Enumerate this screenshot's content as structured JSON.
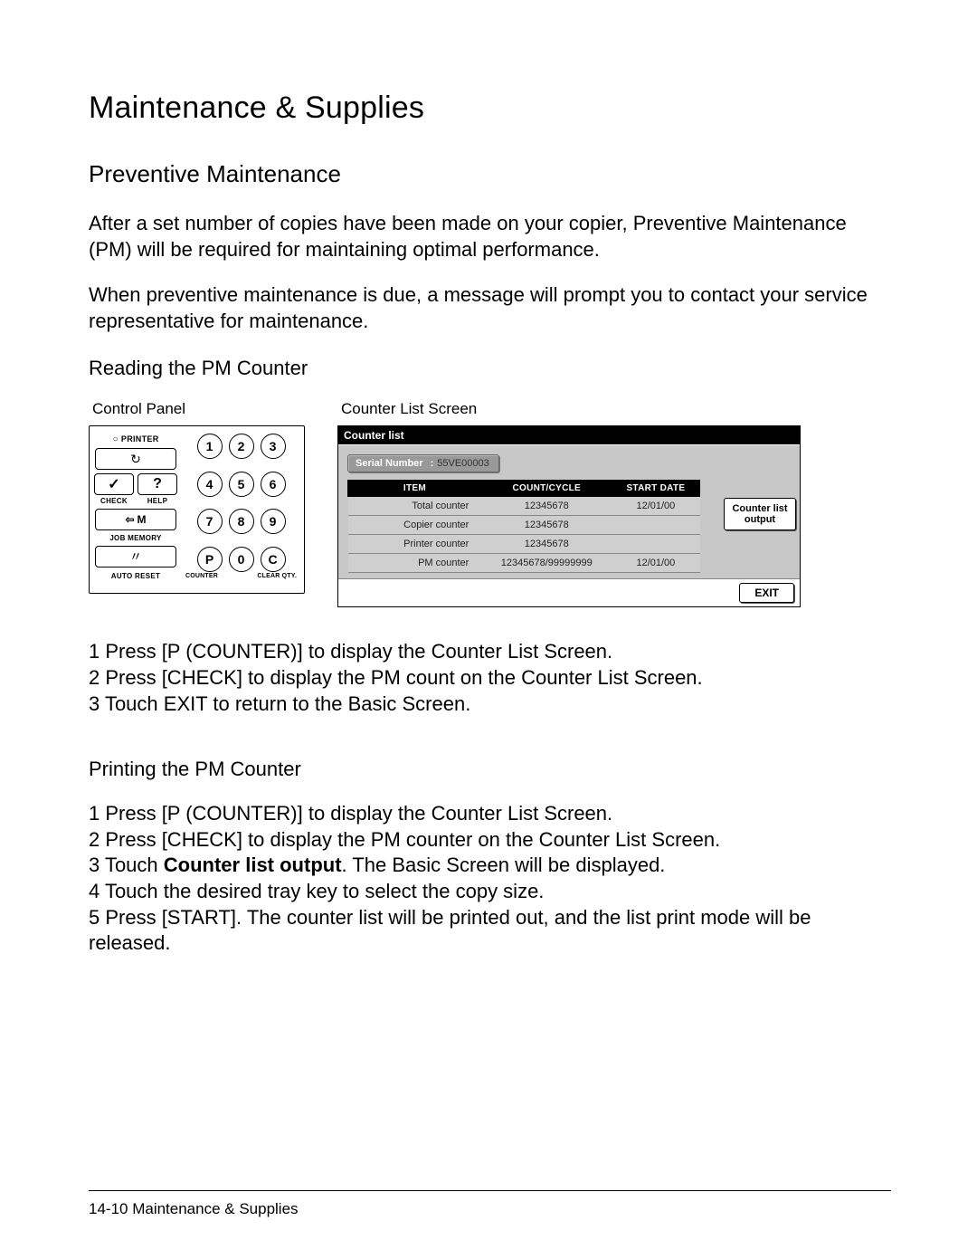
{
  "title": "Maintenance & Supplies",
  "section_preventive": "Preventive Maintenance",
  "para1": "After a set number of copies have been made on your copier, Preventive Maintenance (PM) will be required for maintaining optimal performance.",
  "para2": "When preventive maintenance is due, a message will prompt you to contact your service representative for maintenance.",
  "reading_heading": "Reading the PM Counter",
  "fig_labels": {
    "control_panel": "Control Panel",
    "counter_list": "Counter List Screen"
  },
  "panel": {
    "printer": "PRINTER",
    "check": "CHECK",
    "help": "HELP",
    "m": "M",
    "job_memory": "JOB MEMORY",
    "auto_reset": "AUTO RESET",
    "counter": "COUNTER",
    "clear_qty": "CLEAR QTY.",
    "keypad": [
      "1",
      "2",
      "3",
      "4",
      "5",
      "6",
      "7",
      "8",
      "9",
      "P",
      "0",
      "C"
    ]
  },
  "cls": {
    "title": "Counter list",
    "serial_label": "Serial Number",
    "serial_value": "55VE00003",
    "headers": [
      "ITEM",
      "COUNT/CYCLE",
      "START DATE"
    ],
    "rows": [
      {
        "item": "Total counter",
        "count": "12345678",
        "date": "12/01/00"
      },
      {
        "item": "Copier counter",
        "count": "12345678",
        "date": ""
      },
      {
        "item": "Printer counter",
        "count": "12345678",
        "date": ""
      },
      {
        "item": "PM counter",
        "count": "12345678/99999999",
        "date": "12/01/00"
      }
    ],
    "output_btn_line1": "Counter list",
    "output_btn_line2": "output",
    "exit": "EXIT"
  },
  "reading_steps": [
    "1  Press [P (COUNTER)] to display the Counter List Screen.",
    "2  Press [CHECK] to display the PM count on the Counter List Screen.",
    "3  Touch EXIT to return to the Basic Screen."
  ],
  "printing_heading": "Printing the PM Counter",
  "printing_steps": {
    "s1": "1  Press [P (COUNTER)] to display the Counter List Screen.",
    "s2": "2  Press [CHECK] to display the PM counter on the Counter List Screen.",
    "s3a": "3  Touch ",
    "s3b": "Counter list output",
    "s3c": ". The Basic Screen will be displayed.",
    "s4": "4  Touch the desired tray key to select the copy size.",
    "s5": "5  Press [START]. The counter list will be printed out, and the list print mode will be released."
  },
  "footer": "14-10 Maintenance & Supplies"
}
